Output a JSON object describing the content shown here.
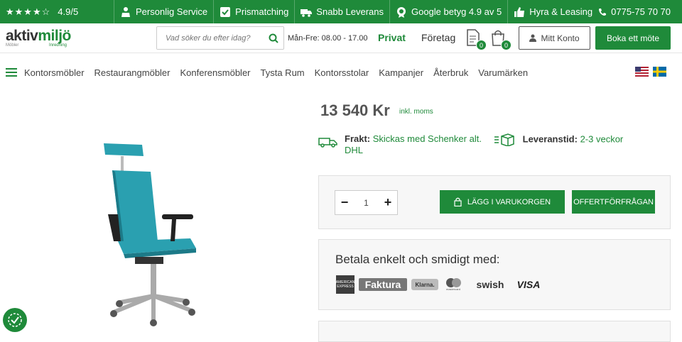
{
  "topbar": {
    "stars": "★★★★☆",
    "rating": "4.9/5",
    "usps": [
      {
        "label": "Personlig Service",
        "icon": "person-service-icon"
      },
      {
        "label": "Prismatching",
        "icon": "price-match-icon"
      },
      {
        "label": "Snabb Leverans",
        "icon": "truck-icon"
      },
      {
        "label": "Google betyg 4.9 av 5",
        "icon": "google-badge-icon"
      },
      {
        "label": "Hyra & Leasing",
        "icon": "thumbs-up-icon"
      }
    ],
    "phone": "0775-75 70 70"
  },
  "header": {
    "logo_main": "aktiv",
    "logo_green": "miljö",
    "logo_sub_left": "Möbler",
    "logo_sub_right": "Inredning",
    "search_placeholder": "Vad söker du efter idag?",
    "hours": "Mån-Fre: 08.00 - 17.00",
    "segment_privat": "Privat",
    "segment_foretag": "Företag",
    "quote_count": "0",
    "cart_count": "0",
    "account_label": "Mitt Konto",
    "book_label": "Boka ett möte"
  },
  "nav": {
    "items": [
      "Kontorsmöbler",
      "Restaurangmöbler",
      "Konferensmöbler",
      "Tysta Rum",
      "Kontorsstolar",
      "Kampanjer",
      "Återbruk",
      "Varumärken"
    ]
  },
  "product": {
    "price": "13 540 Kr",
    "vat_note": "inkl. moms",
    "shipping_label": "Frakt:",
    "shipping_value": "Skickas med Schenker alt. DHL",
    "delivery_label": "Leveranstid:",
    "delivery_value": "2-3 veckor",
    "quantity": "1",
    "qty_minus": "−",
    "qty_plus": "+",
    "add_to_cart": "LÄGG I VARUKORGEN",
    "quote_request": "OFFERTFÖRFRÅGAN",
    "chair_color": "#2aa0b0"
  },
  "payment": {
    "title": "Betala enkelt och smidigt med:",
    "methods": {
      "amex": "AMERICAN EXPRESS",
      "faktura": "Faktura",
      "klarna": "Klarna.",
      "mastercard": "mastercard",
      "swish": "swish",
      "visa": "VISA"
    }
  },
  "colors": {
    "brand_green": "#1f8a3a"
  }
}
